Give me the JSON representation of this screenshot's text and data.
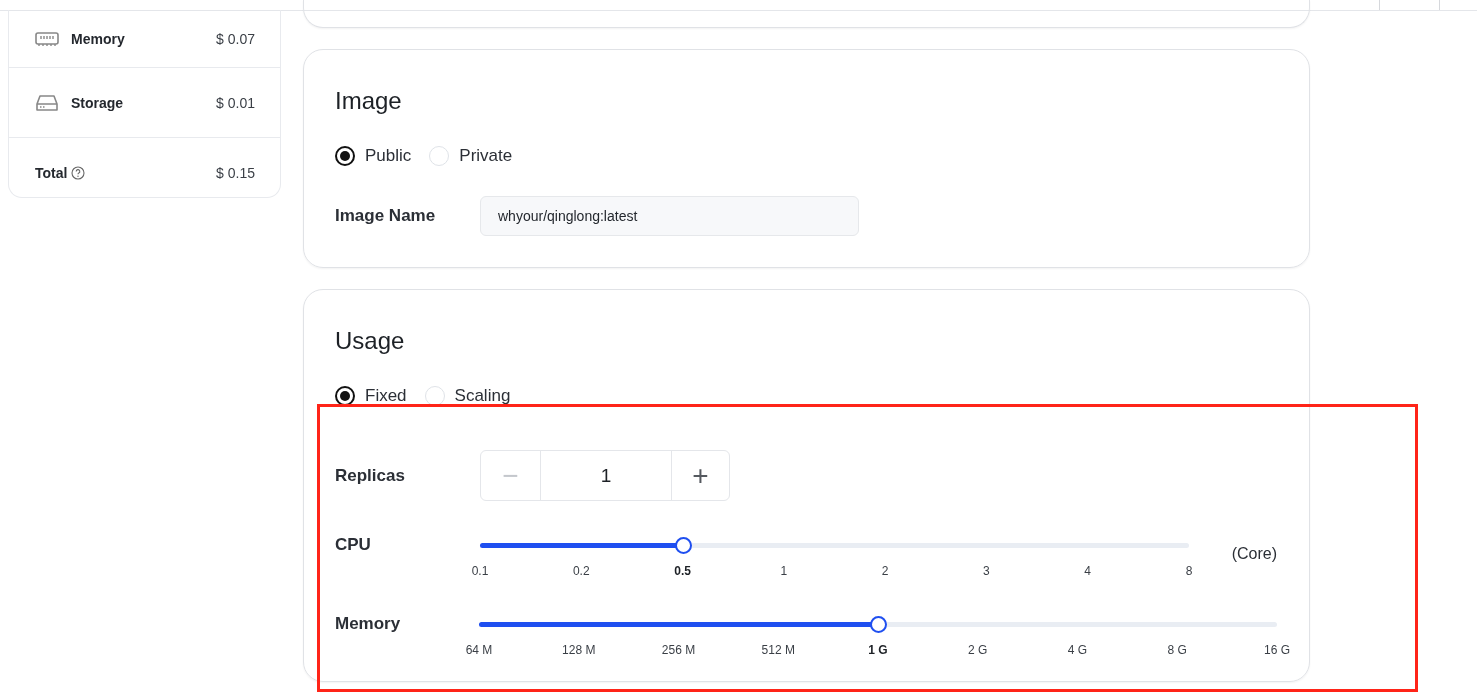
{
  "cost_summary": {
    "items": [
      {
        "kind": "memory",
        "label": "Memory",
        "price": "$ 0.07"
      },
      {
        "kind": "storage",
        "label": "Storage",
        "price": "$ 0.01"
      }
    ],
    "total": {
      "label": "Total",
      "price": "$ 0.15"
    }
  },
  "image": {
    "title": "Image",
    "options": [
      {
        "label": "Public",
        "selected": true
      },
      {
        "label": "Private",
        "selected": false
      }
    ],
    "name_label": "Image Name",
    "name_value": "whyour/qinglong:latest"
  },
  "usage": {
    "title": "Usage",
    "options": [
      {
        "label": "Fixed",
        "selected": true
      },
      {
        "label": "Scaling",
        "selected": false
      }
    ],
    "replicas": {
      "label": "Replicas",
      "minus": "−",
      "value": "1",
      "plus": "+"
    },
    "sliders": [
      {
        "label": "CPU",
        "unit": "(Core)",
        "level": 0.2857,
        "ticks": [
          {
            "label": "0.1",
            "selected": false
          },
          {
            "label": "0.2",
            "selected": false
          },
          {
            "label": "0.5",
            "selected": true
          },
          {
            "label": "1",
            "selected": false
          },
          {
            "label": "2",
            "selected": false
          },
          {
            "label": "3",
            "selected": false
          },
          {
            "label": "4",
            "selected": false
          },
          {
            "label": "8",
            "selected": false
          }
        ]
      },
      {
        "label": "Memory",
        "level": 0.5,
        "ticks": [
          {
            "label": "64 M",
            "selected": false
          },
          {
            "label": "128 M",
            "selected": false
          },
          {
            "label": "256 M",
            "selected": false
          },
          {
            "label": "512 M",
            "selected": false
          },
          {
            "label": "1 G",
            "selected": true
          },
          {
            "label": "2 G",
            "selected": false
          },
          {
            "label": "4 G",
            "selected": false
          },
          {
            "label": "8 G",
            "selected": false
          },
          {
            "label": "16 G",
            "selected": false
          }
        ]
      }
    ]
  }
}
